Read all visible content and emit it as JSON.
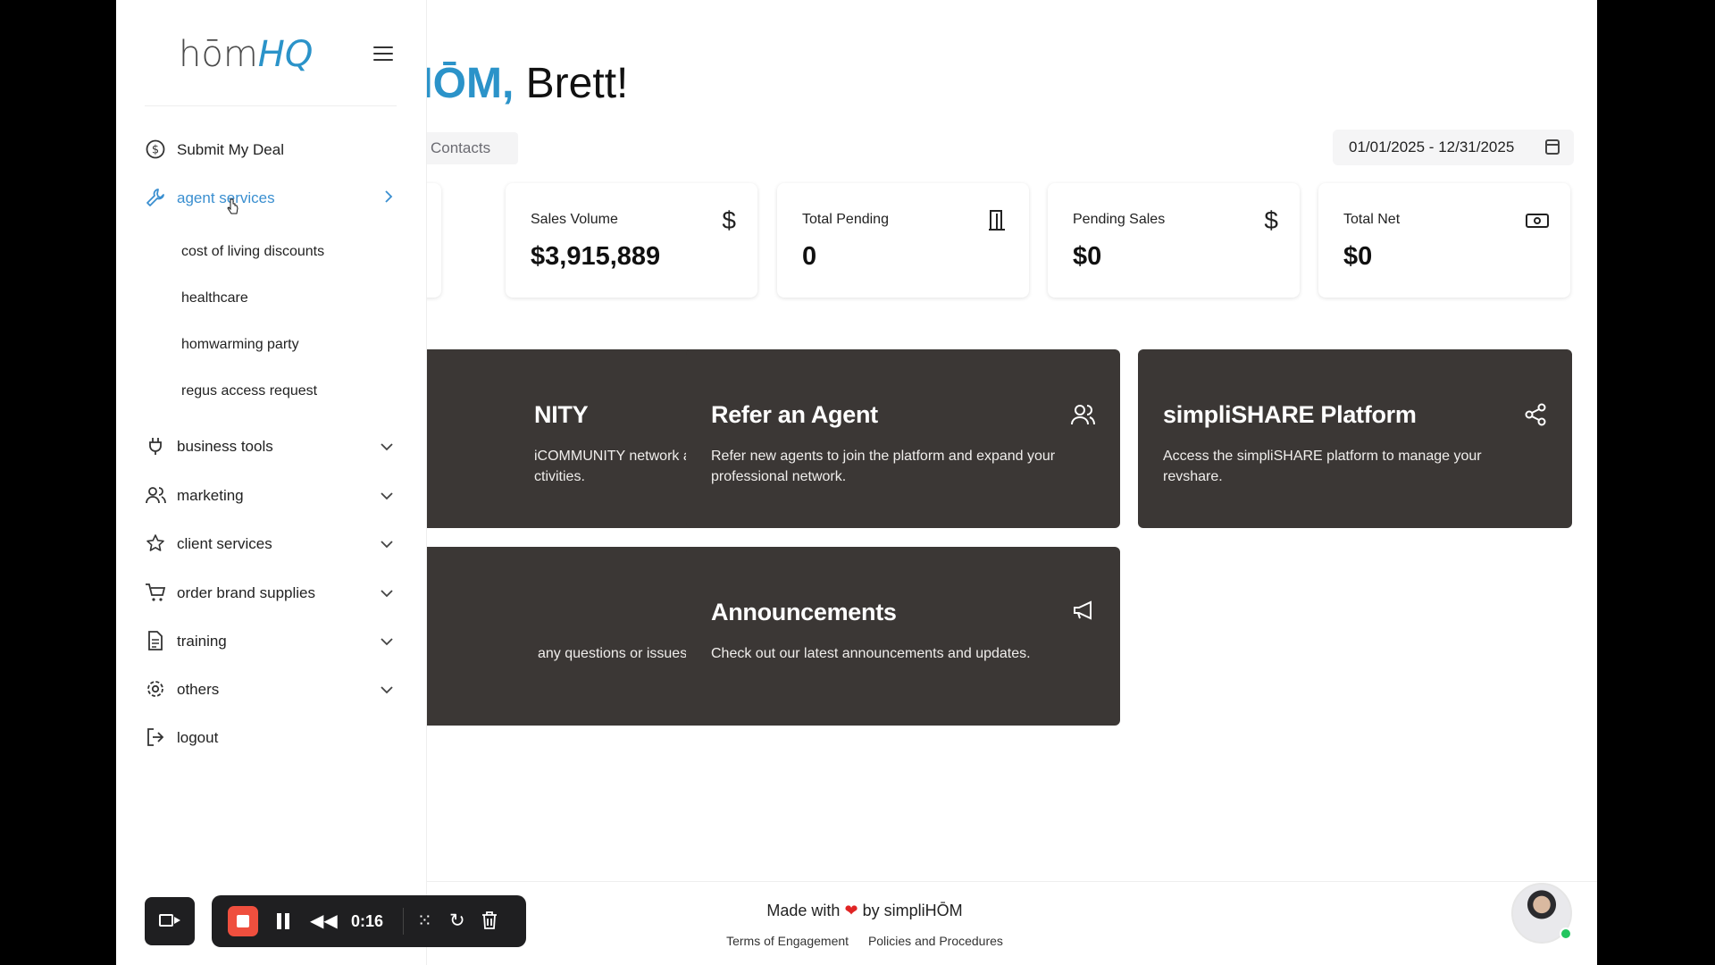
{
  "header": {
    "greeting_accent": "HŌM,",
    "greeting_name": " Brett!"
  },
  "tabs": {
    "contacts": "Contacts"
  },
  "date_range": "01/01/2025 - 12/31/2025",
  "stats": [
    {
      "label": "Sales Volume",
      "value": "$3,915,889",
      "icon": "dollar-icon"
    },
    {
      "label": "Total Pending",
      "value": "0",
      "icon": "door-icon"
    },
    {
      "label": "Pending Sales",
      "value": "$0",
      "icon": "dollar-icon"
    },
    {
      "label": "Total Net",
      "value": "$0",
      "icon": "cash-icon"
    }
  ],
  "cards": [
    {
      "title": "NITY",
      "desc": "iCOMMUNITY network and stay\nctivities.",
      "icon": "users-icon"
    },
    {
      "title": "Refer an Agent",
      "desc": "Refer new agents to join the platform and expand your professional network.",
      "icon": "users-icon"
    },
    {
      "title": "simpliSHARE Platform",
      "desc": "Access the simpliSHARE platform to manage your revshare.",
      "icon": "share-icon"
    },
    {
      "title": "",
      "desc": "any questions or issues you",
      "icon": "headphones-icon"
    },
    {
      "title": "Announcements",
      "desc": "Check out our latest announcements and updates.",
      "icon": "megaphone-icon"
    }
  ],
  "sidebar": {
    "logo_hom": "hōm",
    "logo_hq": "HQ",
    "items": [
      {
        "label": "Submit My Deal",
        "icon": "dollar-circle-icon"
      },
      {
        "label": "agent services",
        "icon": "wrench-icon",
        "active": true
      },
      {
        "label": "business tools",
        "icon": "plug-icon"
      },
      {
        "label": "marketing",
        "icon": "users-icon"
      },
      {
        "label": "client services",
        "icon": "star-icon"
      },
      {
        "label": "order brand supplies",
        "icon": "cart-icon"
      },
      {
        "label": "training",
        "icon": "document-icon"
      },
      {
        "label": "others",
        "icon": "gear-icon"
      },
      {
        "label": "logout",
        "icon": "logout-icon"
      }
    ],
    "subitems": [
      "cost of living discounts",
      "healthcare",
      "homwarming party",
      "regus access request"
    ]
  },
  "footer": {
    "made_prefix": "Made with",
    "made_suffix": "by simpliHŌM",
    "terms": "Terms of Engagement",
    "policies": "Policies and Procedures"
  },
  "recorder": {
    "time": "0:16"
  },
  "colors": {
    "accent": "#2b93c9",
    "card_bg": "#3b3735",
    "record": "#ef4f3e",
    "active_nav": "#3a8fd0"
  }
}
